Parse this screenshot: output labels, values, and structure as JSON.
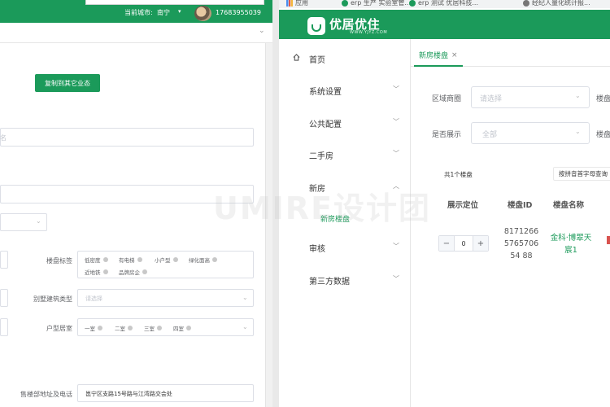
{
  "left_window": {
    "header": {
      "city_label": "当前城市:",
      "city_value": "南宁",
      "phone": "17683955039"
    },
    "copy_button": "复制到其它业态",
    "field_a_placeholder": "名",
    "tags": {
      "label": "楼盘标签",
      "items": [
        "低密度",
        "有电梯",
        "小户型",
        "绿化面高",
        "近地铁",
        "品牌房企"
      ]
    },
    "villa": {
      "label": "别墅建筑类型",
      "placeholder": "请选择"
    },
    "layout": {
      "label": "户型居室",
      "items": [
        "一室",
        "二室",
        "三室",
        "四室"
      ]
    },
    "sales": {
      "label": "售楼部地址及电话",
      "value": "邕宁区支路15号路与江湾路交会处"
    }
  },
  "right_window": {
    "bookmarks": [
      "应用",
      "erp 生产 实验室管...",
      "erp 测试 优居科技...",
      "经纪人量化统计报..."
    ],
    "logo": {
      "text": "优居优住",
      "url": "WWW.YJYZ.COM"
    },
    "sidebar": {
      "home": "首页",
      "system": "系统设置",
      "public": "公共配置",
      "second_hand": "二手房",
      "new_house": "新房",
      "new_house_sub": "新房楼盘",
      "audit": "审核",
      "third_party": "第三方数据"
    },
    "tab": {
      "label": "新房楼盘",
      "close": "×"
    },
    "filters": {
      "area_label": "区域商圈",
      "area_placeholder": "请选择",
      "area2_label": "楼盘",
      "show_label": "是否展示",
      "show_value": "全部",
      "show2_label": "楼盘"
    },
    "total": "共1个楼盘",
    "sort_button": "按拼音首字母查询",
    "table": {
      "headers": [
        "展示定位",
        "楼盘ID",
        "楼盘名称"
      ],
      "rows": [
        {
          "position": "0",
          "id": "8171266576570654 88",
          "name": "金科·博翠天宸1"
        }
      ]
    },
    "stepper": {
      "minus": "−",
      "plus": "+"
    }
  },
  "watermark": "UMIRE设计团",
  "colors": {
    "brand_green": "#1b9a5a",
    "border": "#dcdfe6",
    "placeholder": "#c0c4cc"
  }
}
